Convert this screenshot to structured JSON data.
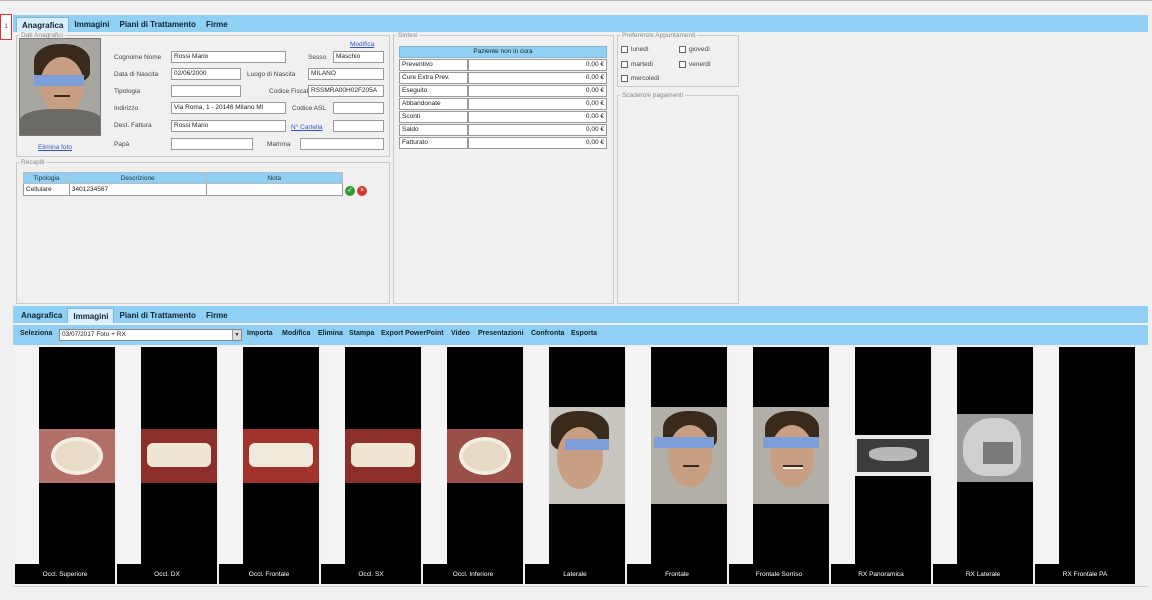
{
  "marker": "1",
  "tabs_top": [
    "Anagrafica",
    "Immagini",
    "Piani di Trattamento",
    "Firme"
  ],
  "dati": {
    "legend": "Dati Anagrafici",
    "modifica": "Modifica",
    "elimina_foto": "Elimina foto",
    "cognome_label": "Cognome Nome",
    "cognome_value": "Rossi Mario",
    "sesso_label": "Sesso",
    "sesso_value": "Maschio",
    "nascita_label": "Data di Nascita",
    "nascita_value": "02/06/2000",
    "luogo_label": "Luogo di Nascita",
    "luogo_value": "MILANO",
    "tipologia_label": "Tipologia",
    "tipologia_value": "",
    "cf_label": "Codice Fiscale",
    "cf_value": "RSSMRA00H02F205A",
    "indirizzo_label": "Indirizzo",
    "indirizzo_value": "Via Roma, 1 - 20146 Milano MI",
    "asl_label": "Codice ASL",
    "asl_value": "",
    "fattura_label": "Dest. Fattura",
    "fattura_value": "Rossi Mario",
    "cartella_label": "N° Cartella",
    "cartella_value": "",
    "papa_label": "Papà",
    "papa_value": "",
    "mamma_label": "Mamma",
    "mamma_value": ""
  },
  "recapiti": {
    "legend": "Recapiti",
    "headers": [
      "Tipologia",
      "Descrizione",
      "Nota"
    ],
    "row": {
      "tipologia": "Cellulare",
      "descrizione": "3401234567",
      "nota": ""
    }
  },
  "sintesi": {
    "legend": "Sintesi",
    "status": "Paziente non in cura",
    "rows": [
      {
        "label": "Preventivo",
        "value": "0,00 €"
      },
      {
        "label": "Cure Extra Prev.",
        "value": "0,00 €"
      },
      {
        "label": "Eseguito",
        "value": "0,00 €"
      },
      {
        "label": "Abbandonate",
        "value": "0,00 €"
      },
      {
        "label": "Sconti",
        "value": "0,00 €"
      },
      {
        "label": "Saldo",
        "value": "0,00 €"
      },
      {
        "label": "Fatturato",
        "value": "0,00 €"
      }
    ]
  },
  "preferenze": {
    "legend": "Preferenze Appuntamenti",
    "days": [
      "lunedì",
      "giovedì",
      "martedì",
      "venerdì",
      "mercoledì"
    ]
  },
  "scadenze": {
    "legend": "Scadenze pagamenti"
  },
  "tabs_bottom": [
    "Anagrafica",
    "Immagini",
    "Piani di Trattamento",
    "Firme"
  ],
  "toolbar": {
    "seleziona": "Seleziona",
    "select_value": "03/07/2017 Foto + RX",
    "items": [
      "Importa",
      "Modifica",
      "Elimina",
      "Stampa",
      "Export PowerPoint",
      "Video",
      "Presentazioni",
      "Confronta",
      "Esporta"
    ]
  },
  "thumbs": [
    "Occl. Superiore",
    "Occl. DX",
    "Occl. Frontale",
    "Occl. SX",
    "Occl. Inferiore",
    "Laterale",
    "Frontale",
    "Frontale Sorriso",
    "RX Panoramica",
    "RX Laterale",
    "RX Frontale PA"
  ],
  "colors": {
    "accent": "#8fd0f4",
    "tab_active": "#d9eefc",
    "link": "#3355cc"
  }
}
